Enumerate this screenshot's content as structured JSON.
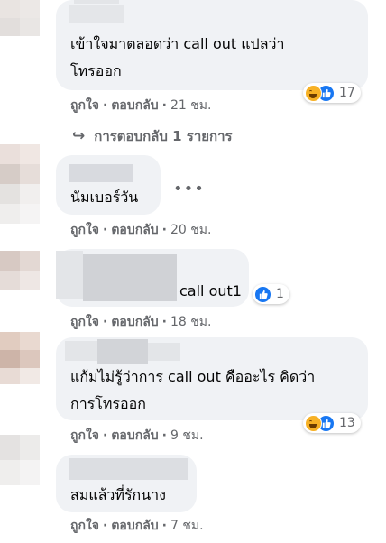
{
  "comments": [
    {
      "text_lines": [
        "เข้าใจมาตลอดว่า call out แปลว่า",
        "โทรออก"
      ],
      "like_label": "ถูกใจ",
      "reply_label": "ตอบกลับ",
      "time": "21 ชม.",
      "reactions": [
        "haha",
        "like"
      ],
      "reaction_count": "17",
      "replies_link": "การตอบกลับ 1 รายการ"
    },
    {
      "text_lines": [
        "นัมเบอร์วัน"
      ],
      "like_label": "ถูกใจ",
      "reply_label": "ตอบกลับ",
      "time": "20 ชม."
    },
    {
      "text_lines": [
        "call out1"
      ],
      "like_label": "ถูกใจ",
      "reply_label": "ตอบกลับ",
      "time": "18 ชม.",
      "reactions": [
        "like"
      ],
      "reaction_count": "1"
    },
    {
      "text_lines": [
        "แก้มไม่รู้ว่าการ call out คืออะไร คิดว่า",
        "การโทรออก"
      ],
      "like_label": "ถูกใจ",
      "reply_label": "ตอบกลับ",
      "time": "9 ชม.",
      "reactions": [
        "haha",
        "like"
      ],
      "reaction_count": "13"
    },
    {
      "text_lines": [
        "สมแล้วที่รักนาง"
      ],
      "like_label": "ถูกใจ",
      "reply_label": "ตอบกลับ",
      "time": "7 ชม."
    }
  ],
  "separator": "·",
  "more_options_icon": "more-horizontal-icon",
  "reply_arrow_icon": "reply-arrow-icon",
  "colors": {
    "bubble": "#f0f2f5",
    "meta_text": "#65676b",
    "like_blue": "#1877f2",
    "haha_yellow": "#f7b125"
  }
}
